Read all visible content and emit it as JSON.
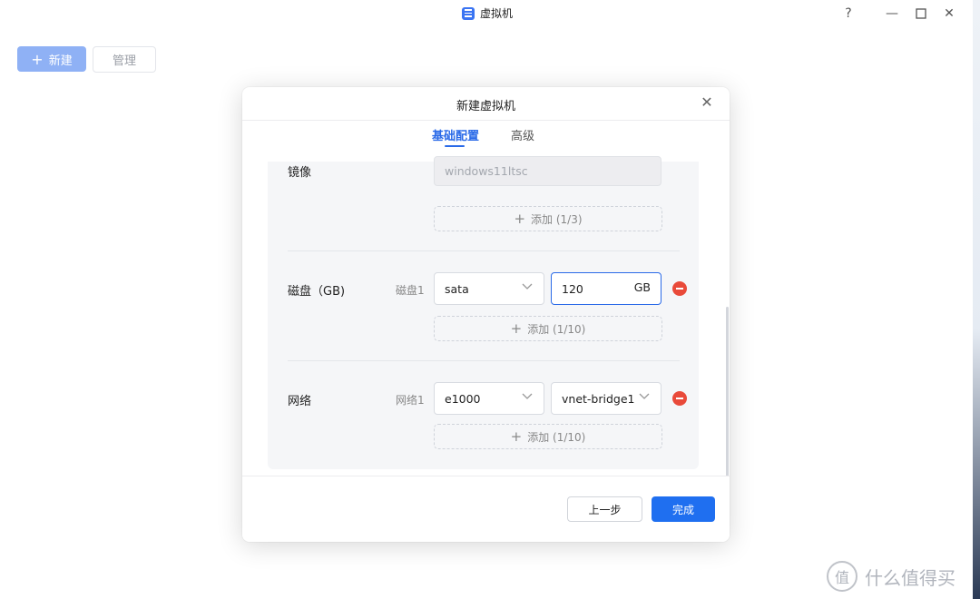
{
  "window": {
    "title": "虚拟机",
    "controls": {
      "help": "?",
      "minimize": "—",
      "maximize": "☐",
      "close": "✕"
    }
  },
  "toolbar": {
    "new_icon": "+",
    "new_label": "新建",
    "manage_label": "管理"
  },
  "dialog": {
    "title": "新建虚拟机",
    "close": "✕",
    "tabs": [
      {
        "label": "基础配置",
        "active": true
      },
      {
        "label": "高级",
        "active": false
      }
    ],
    "image": {
      "label": "镜像",
      "value": "windows11ltsc",
      "add_label": "添加 (1/3)"
    },
    "disk": {
      "label": "磁盘（GB)",
      "item_label": "磁盘1",
      "type": "sata",
      "size": "120",
      "unit": "GB",
      "add_label": "添加 (1/10)"
    },
    "network": {
      "label": "网络",
      "item_label": "网络1",
      "adapter": "e1000",
      "bridge": "vnet-bridge1",
      "add_label": "添加 (1/10)"
    },
    "footer": {
      "prev_label": "上一步",
      "done_label": "完成"
    }
  },
  "watermark": {
    "circle": "值",
    "text": "什么值得买"
  },
  "colors": {
    "accent": "#1f6ff0",
    "remove": "#e94a3a",
    "new_button": "#8fb1f5"
  }
}
